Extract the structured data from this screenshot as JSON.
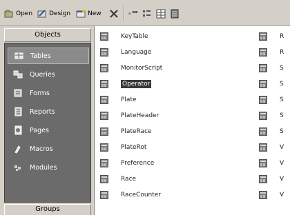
{
  "toolbar": {
    "open_label": "Open",
    "design_label": "Design",
    "new_label": "New"
  },
  "left_panel": {
    "objects_header": "Objects",
    "groups_header": "Groups",
    "items": [
      {
        "label": "Tables",
        "icon": "table-icon",
        "selected": true
      },
      {
        "label": "Queries",
        "icon": "query-icon",
        "selected": false
      },
      {
        "label": "Forms",
        "icon": "form-icon",
        "selected": false
      },
      {
        "label": "Reports",
        "icon": "report-icon",
        "selected": false
      },
      {
        "label": "Pages",
        "icon": "page-icon",
        "selected": false
      },
      {
        "label": "Macros",
        "icon": "macro-icon",
        "selected": false
      },
      {
        "label": "Modules",
        "icon": "module-icon",
        "selected": false
      }
    ]
  },
  "tables": [
    {
      "name": "KeyTable"
    },
    {
      "name": "Language"
    },
    {
      "name": "MonitorScript"
    },
    {
      "name": "Operator",
      "selected": true
    },
    {
      "name": "Plate"
    },
    {
      "name": "PlateHeader"
    },
    {
      "name": "PlateRace"
    },
    {
      "name": "PlateRot"
    },
    {
      "name": "Preference"
    },
    {
      "name": "Race"
    },
    {
      "name": "RaceCounter"
    }
  ],
  "second_column_initials": [
    "R",
    "R",
    "S",
    "S",
    "S",
    "S",
    "S",
    "V",
    "V",
    "V",
    "V"
  ]
}
